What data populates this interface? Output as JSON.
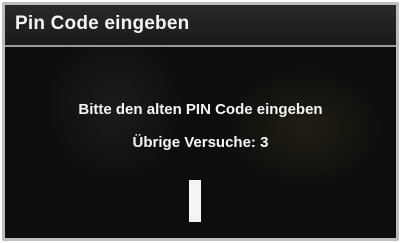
{
  "dialog": {
    "title": "Pin Code eingeben",
    "prompt": "Bitte den alten PIN Code eingeben",
    "remaining_attempts": "Übrige Versuche: 3"
  },
  "pin": {
    "value": ""
  },
  "colors": {
    "background": "#0b0b0b",
    "text": "#f5f5f5",
    "cursor": "#f4f4f4",
    "border": "#bdbdbd"
  }
}
